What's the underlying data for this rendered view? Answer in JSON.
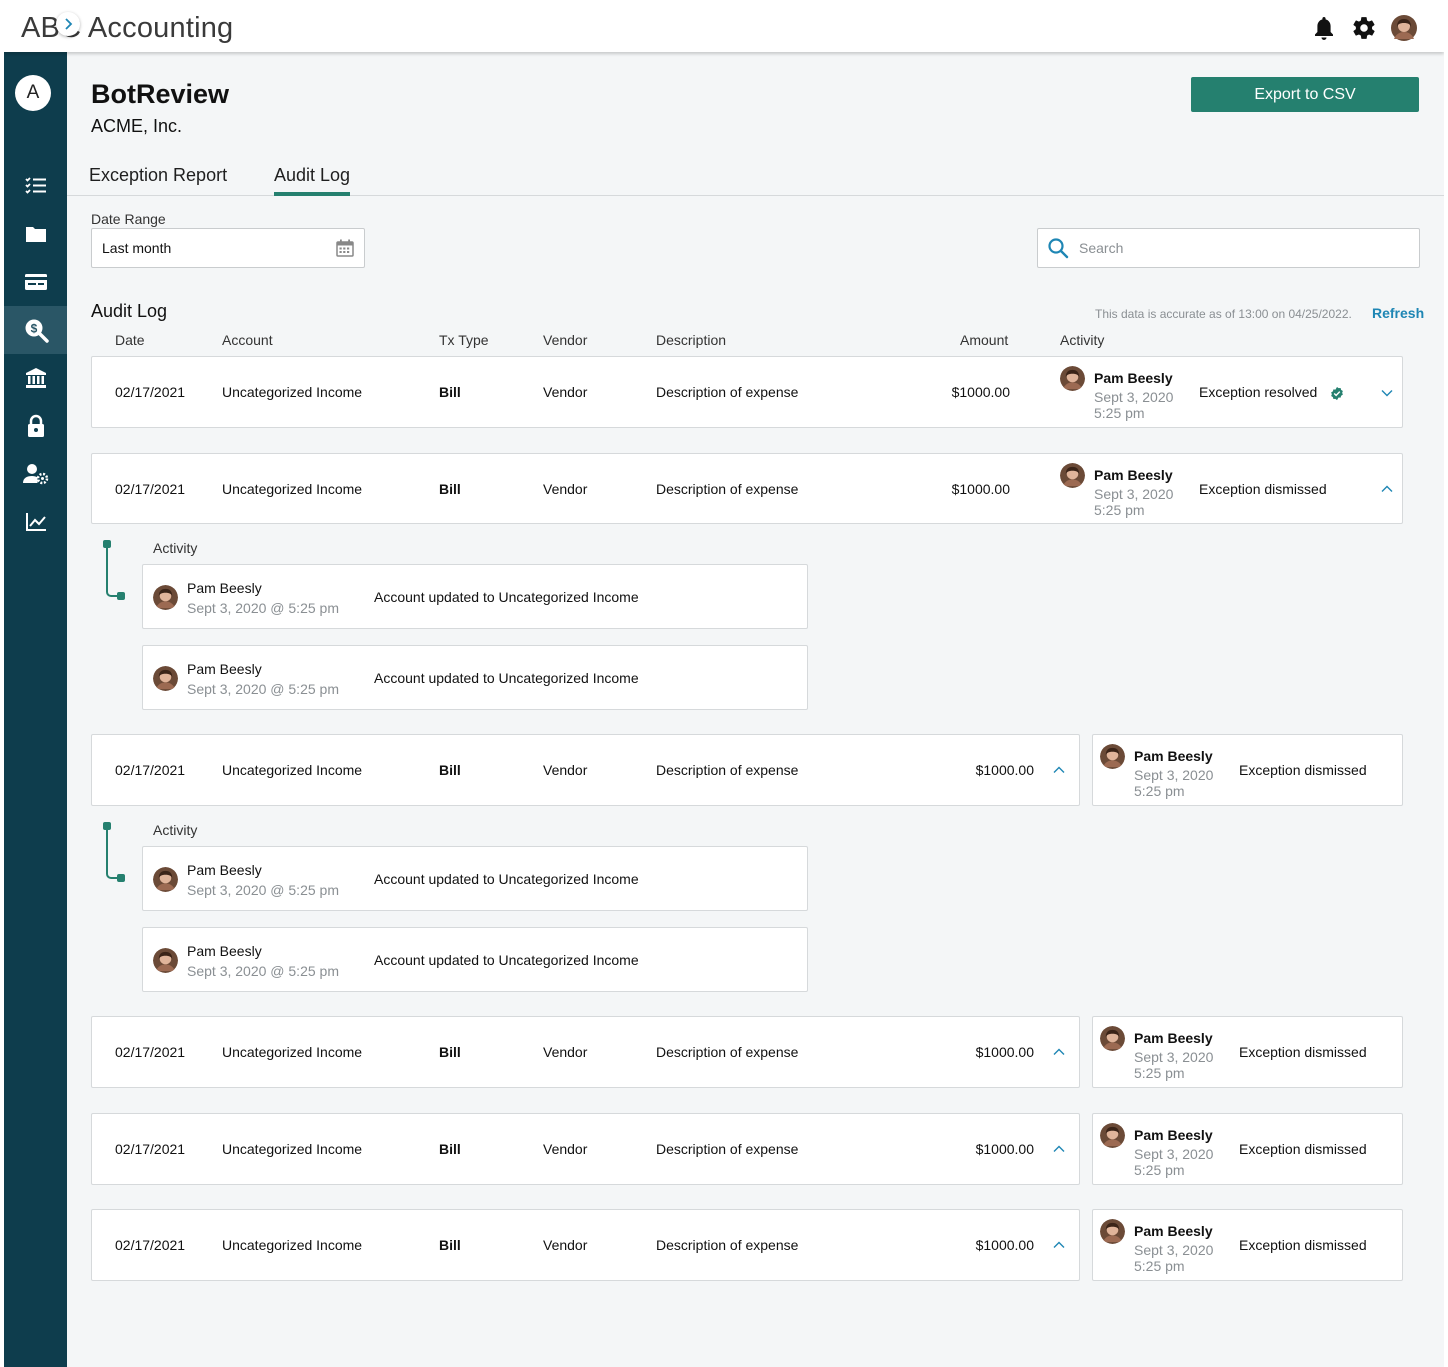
{
  "app": {
    "title": "ABC Accounting"
  },
  "page": {
    "title": "BotReview",
    "subtitle": "ACME, Inc.",
    "export_label": "Export to CSV"
  },
  "tabs": [
    {
      "label": "Exception Report",
      "active": false
    },
    {
      "label": "Audit Log",
      "active": true
    }
  ],
  "filters": {
    "date_range_label": "Date Range",
    "date_range_value": "Last month",
    "search_placeholder": "Search"
  },
  "section": {
    "title": "Audit Log",
    "accuracy_note": "This data is accurate as of 13:00 on 04/25/2022.",
    "refresh_label": "Refresh"
  },
  "sidebar": {
    "user_initial": "A",
    "items": [
      "checklist-icon",
      "folder-icon",
      "credit-card-icon",
      "dollar-search-icon",
      "bank-icon",
      "lock-icon",
      "user-settings-icon",
      "chart-icon"
    ],
    "active_index": 3
  },
  "columns": {
    "date": "Date",
    "account": "Account",
    "tx_type": "Tx Type",
    "vendor": "Vendor",
    "description": "Description",
    "amount": "Amount",
    "activity": "Activity"
  },
  "rows": [
    {
      "date": "02/17/2021",
      "account": "Uncategorized Income",
      "tx_type": "Bill",
      "vendor": "Vendor",
      "description": "Description of expense",
      "amount": "$1000.00",
      "user": "Pam Beesly",
      "act_date": "Sept 3, 2020",
      "act_time": "5:25 pm",
      "status": "Exception resolved"
    },
    {
      "date": "02/17/2021",
      "account": "Uncategorized Income",
      "tx_type": "Bill",
      "vendor": "Vendor",
      "description": "Description of expense",
      "amount": "$1000.00",
      "user": "Pam Beesly",
      "act_date": "Sept 3, 2020",
      "act_time": "5:25 pm",
      "status": "Exception dismissed"
    },
    {
      "date": "02/17/2021",
      "account": "Uncategorized Income",
      "tx_type": "Bill",
      "vendor": "Vendor",
      "description": "Description of expense",
      "amount": "$1000.00",
      "user": "Pam Beesly",
      "act_date": "Sept 3, 2020",
      "act_time": "5:25 pm",
      "status": "Exception dismissed"
    },
    {
      "date": "02/17/2021",
      "account": "Uncategorized Income",
      "tx_type": "Bill",
      "vendor": "Vendor",
      "description": "Description of expense",
      "amount": "$1000.00",
      "user": "Pam Beesly",
      "act_date": "Sept 3, 2020",
      "act_time": "5:25 pm",
      "status": "Exception dismissed"
    },
    {
      "date": "02/17/2021",
      "account": "Uncategorized Income",
      "tx_type": "Bill",
      "vendor": "Vendor",
      "description": "Description of expense",
      "amount": "$1000.00",
      "user": "Pam Beesly",
      "act_date": "Sept 3, 2020",
      "act_time": "5:25 pm",
      "status": "Exception dismissed"
    },
    {
      "date": "02/17/2021",
      "account": "Uncategorized Income",
      "tx_type": "Bill",
      "vendor": "Vendor",
      "description": "Description of expense",
      "amount": "$1000.00",
      "user": "Pam Beesly",
      "act_date": "Sept 3, 2020",
      "act_time": "5:25 pm",
      "status": "Exception dismissed"
    }
  ],
  "activity": {
    "label": "Activity",
    "entries": [
      {
        "user": "Pam Beesly",
        "when": "Sept 3, 2020 @ 5:25 pm",
        "text": "Account updated to Uncategorized Income"
      },
      {
        "user": "Pam Beesly",
        "when": "Sept 3, 2020 @ 5:25 pm",
        "text": "Account updated to Uncategorized Income"
      }
    ]
  },
  "colors": {
    "accent": "#25806f",
    "sidebar": "#0e3d4d",
    "link": "#1e86b4"
  }
}
